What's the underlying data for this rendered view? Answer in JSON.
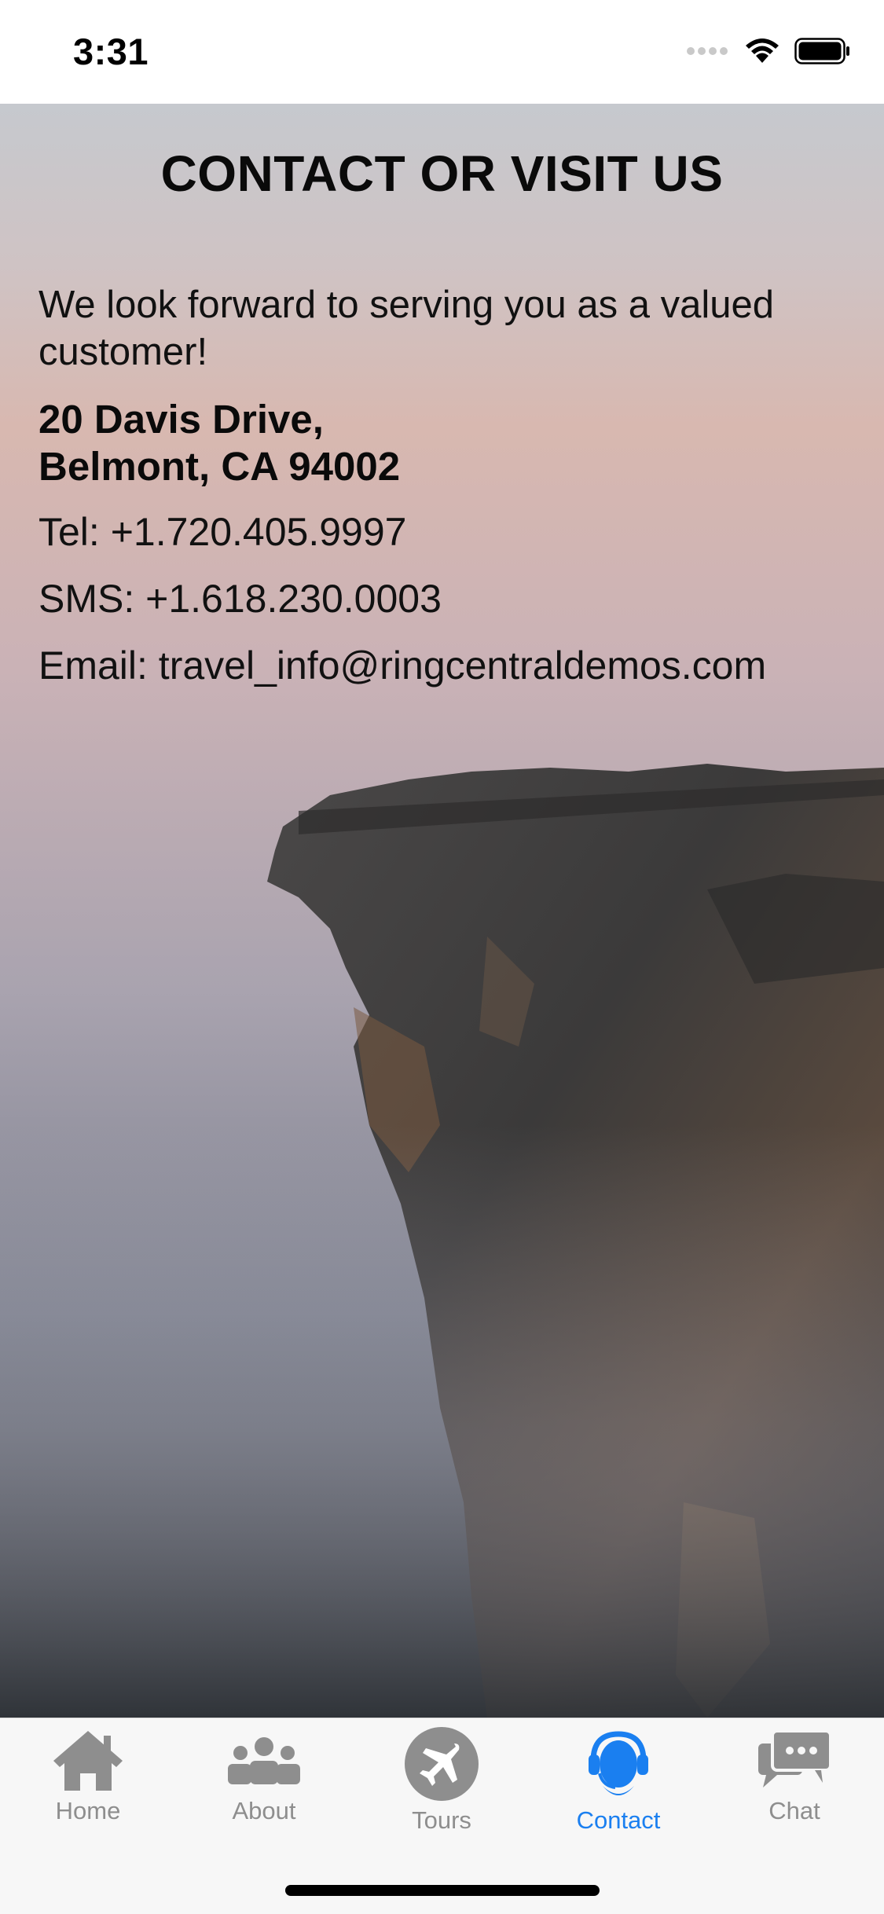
{
  "status_bar": {
    "time": "3:31",
    "icons": [
      "signal-dots-icon",
      "wifi-icon",
      "battery-icon"
    ]
  },
  "page": {
    "title": "CONTACT OR VISIT US",
    "intro": "We look forward to serving you as a valued customer!",
    "address_line1": "20 Davis Drive,",
    "address_line2": "Belmont, CA  94002",
    "tel": "Tel: +1.720.405.9997",
    "sms": "SMS: +1.618.230.0003",
    "email": "Email: travel_info@ringcentraldemos.com"
  },
  "tab_bar": {
    "active_color": "#1a7ff0",
    "inactive_color": "#8e8e8e",
    "tabs": [
      {
        "label": "Home",
        "icon": "home-icon",
        "active": false
      },
      {
        "label": "About",
        "icon": "people-icon",
        "active": false
      },
      {
        "label": "Tours",
        "icon": "plane-icon",
        "active": false
      },
      {
        "label": "Contact",
        "icon": "headset-icon",
        "active": true
      },
      {
        "label": "Chat",
        "icon": "chat-bubbles-icon",
        "active": false
      }
    ]
  }
}
